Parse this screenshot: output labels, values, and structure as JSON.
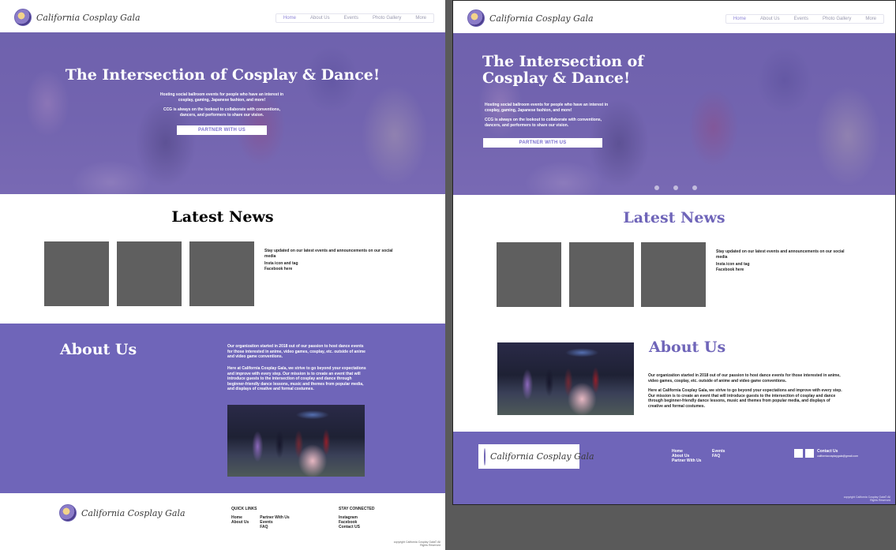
{
  "brand": {
    "name": "California Cosplay Gala"
  },
  "nav": [
    "Home",
    "About Us",
    "Events",
    "Photo Gallery",
    "More"
  ],
  "hero": {
    "title": "The Intersection of Cosplay & Dance!",
    "title_line1": "The Intersection of",
    "title_line2": "Cosplay & Dance!",
    "p1": "Hosting social ballroom events for people who have an interest in cosplay, gaming, Japanese fashion, and more!",
    "p2": "CCG is always on the lookout to collaborate with conventions, dancers, and performers to share our vision.",
    "button": "PARTNER WITH US"
  },
  "news": {
    "title": "Latest News",
    "text1": "Stay updated on our latest events and announcements on our social media",
    "text2": "Insta icon and tag",
    "text3": "Facebook here"
  },
  "about": {
    "title": "About Us",
    "p1": "Our organization started in 2018 out of our passion to host dance events for those interested in anime, video games, cosplay, etc. outside of anime and video game conventions.",
    "p2": "Here at California Cosplay Gala, we strive to go beyond your expectations and improve with every step. Our mission is to create an event that will introduce guests to the intersection of cosplay and dance through beginner-friendly dance lessons, music and themes from popular media, and displays of creative and formal costumes."
  },
  "footer": {
    "quick_links_title": "QUICK LINKS",
    "links_col1": [
      "Home",
      "About Us"
    ],
    "links_col2": [
      "Partner With Us",
      "Events",
      "FAQ"
    ],
    "stay_connected_title": "STAY CONNECTED",
    "connected": [
      "Instagram",
      "Facebook",
      "Contact US"
    ],
    "contact_us": "Contact Us",
    "email": "californiacosplaygala@gmail.com",
    "copyright": "copyright California Cosplay Gala© All Rights Reserved"
  },
  "colors": {
    "accent": "#6f65b9",
    "title_purple": "#6f65b9"
  }
}
